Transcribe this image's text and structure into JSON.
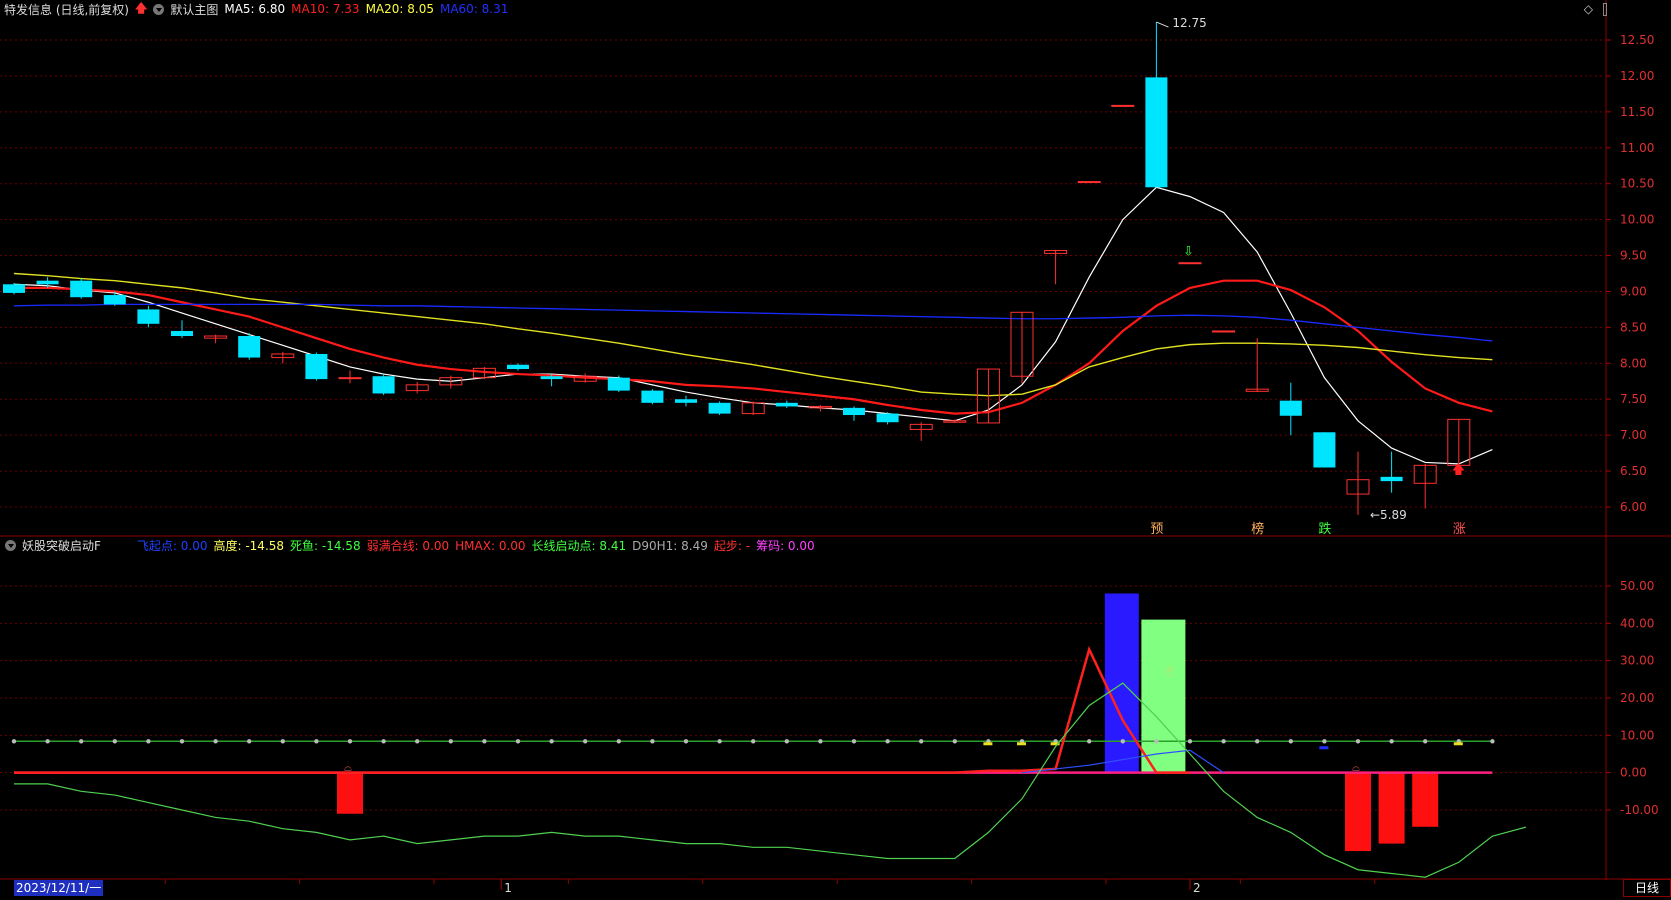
{
  "header": {
    "stock_title": "特发信息 (日线,前复权)",
    "theme_label": "默认主图",
    "ma": [
      {
        "label": "MA5: ",
        "value": "6.80",
        "color": "#ffffff"
      },
      {
        "label": "MA10: ",
        "value": "7.33",
        "color": "#ff2020"
      },
      {
        "label": "MA20: ",
        "value": "8.05",
        "color": "#ffff40"
      },
      {
        "label": "MA60: ",
        "value": "8.31",
        "color": "#2030ff"
      }
    ]
  },
  "indicator_header": {
    "name": "妖股突破启动F",
    "fields": [
      {
        "label": "飞起点: ",
        "value": "0.00",
        "color": "#2040ff"
      },
      {
        "label": "高度: ",
        "value": "-14.58",
        "color": "#ffff60"
      },
      {
        "label": "死鱼: ",
        "value": "-14.58",
        "color": "#40ff40"
      },
      {
        "label": "弱满合线: ",
        "value": "0.00",
        "color": "#ff3030"
      },
      {
        "label": "HMAX: ",
        "value": "0.00",
        "color": "#ff3030"
      },
      {
        "label": "长线启动点: ",
        "value": "8.41",
        "color": "#40ff40"
      },
      {
        "label": "D90H1: ",
        "value": "8.49",
        "color": "#aaaaaa"
      },
      {
        "label": "起步: ",
        "value": "-",
        "color": "#ff3030"
      },
      {
        "label": "筹码: ",
        "value": "0.00",
        "color": "#ff40ff"
      }
    ]
  },
  "main_axis": {
    "labels": [
      "12.75",
      "12.50",
      "12.00",
      "11.50",
      "11.00",
      "10.50",
      "10.00",
      "9.50",
      "9.00",
      "8.50",
      "8.00",
      "7.50",
      "7.00",
      "6.50",
      "6.00"
    ],
    "min": 6.0,
    "max": 12.5
  },
  "ind_axis": {
    "labels": [
      "50.00",
      "40.00",
      "30.00",
      "20.00",
      "10.00",
      "0.00",
      "-10.00"
    ],
    "min": -10,
    "max": 50
  },
  "annotations": {
    "high": "12.75",
    "low": "5.89"
  },
  "signal_labels": [
    "预",
    "榜",
    "跌",
    "涨"
  ],
  "x_axis": {
    "date": "2023/12/11/一",
    "month_marks": [
      "1",
      "2"
    ]
  },
  "period_button": "日线",
  "candles": [
    {
      "o": 9.1,
      "c": 8.98,
      "h": 9.12,
      "l": 8.96
    },
    {
      "o": 9.15,
      "c": 9.1,
      "h": 9.2,
      "l": 9.05
    },
    {
      "o": 9.15,
      "c": 8.92,
      "h": 9.18,
      "l": 8.9
    },
    {
      "o": 8.95,
      "c": 8.82,
      "h": 9.0,
      "l": 8.8
    },
    {
      "o": 8.75,
      "c": 8.55,
      "h": 8.8,
      "l": 8.5
    },
    {
      "o": 8.45,
      "c": 8.38,
      "h": 8.6,
      "l": 8.35
    },
    {
      "o": 8.35,
      "c": 8.38,
      "h": 8.4,
      "l": 8.28
    },
    {
      "o": 8.38,
      "c": 8.08,
      "h": 8.42,
      "l": 8.05
    },
    {
      "o": 8.08,
      "c": 8.13,
      "h": 8.16,
      "l": 8.0
    },
    {
      "o": 8.13,
      "c": 7.78,
      "h": 8.15,
      "l": 7.76
    },
    {
      "o": 7.8,
      "c": 7.8,
      "h": 7.9,
      "l": 7.72
    },
    {
      "o": 7.82,
      "c": 7.58,
      "h": 7.85,
      "l": 7.56
    },
    {
      "o": 7.62,
      "c": 7.7,
      "h": 7.74,
      "l": 7.58
    },
    {
      "o": 7.7,
      "c": 7.8,
      "h": 7.83,
      "l": 7.65
    },
    {
      "o": 7.8,
      "c": 7.93,
      "h": 7.95,
      "l": 7.78
    },
    {
      "o": 7.98,
      "c": 7.92,
      "h": 8.0,
      "l": 7.9
    },
    {
      "o": 7.82,
      "c": 7.78,
      "h": 7.85,
      "l": 7.68
    },
    {
      "o": 7.75,
      "c": 7.82,
      "h": 7.86,
      "l": 7.73
    },
    {
      "o": 7.8,
      "c": 7.62,
      "h": 7.83,
      "l": 7.6
    },
    {
      "o": 7.62,
      "c": 7.45,
      "h": 7.64,
      "l": 7.43
    },
    {
      "o": 7.5,
      "c": 7.45,
      "h": 7.55,
      "l": 7.4
    },
    {
      "o": 7.45,
      "c": 7.3,
      "h": 7.47,
      "l": 7.28
    },
    {
      "o": 7.3,
      "c": 7.45,
      "h": 7.47,
      "l": 7.28
    },
    {
      "o": 7.45,
      "c": 7.4,
      "h": 7.48,
      "l": 7.38
    },
    {
      "o": 7.38,
      "c": 7.4,
      "h": 7.42,
      "l": 7.33
    },
    {
      "o": 7.38,
      "c": 7.28,
      "h": 7.4,
      "l": 7.2
    },
    {
      "o": 7.3,
      "c": 7.18,
      "h": 7.32,
      "l": 7.15
    },
    {
      "o": 7.08,
      "c": 7.15,
      "h": 7.18,
      "l": 6.92
    },
    {
      "o": 7.18,
      "c": 7.2,
      "h": 7.22,
      "l": 7.17
    },
    {
      "o": 7.17,
      "c": 7.92,
      "h": 7.92,
      "l": 7.17
    },
    {
      "o": 7.82,
      "c": 8.71,
      "h": 8.71,
      "l": 7.72
    },
    {
      "o": 9.53,
      "c": 9.57,
      "h": 9.58,
      "l": 9.1
    },
    {
      "o": 10.53,
      "c": 10.53,
      "h": 10.53,
      "l": 10.53
    },
    {
      "o": 11.59,
      "c": 11.59,
      "h": 11.59,
      "l": 11.59
    },
    {
      "o": 11.98,
      "c": 10.45,
      "h": 12.75,
      "l": 10.45
    },
    {
      "o": 9.4,
      "c": 9.4,
      "h": 9.4,
      "l": 9.4
    },
    {
      "o": 8.45,
      "c": 8.45,
      "h": 8.45,
      "l": 8.45
    },
    {
      "o": 7.61,
      "c": 7.64,
      "h": 8.35,
      "l": 7.6
    },
    {
      "o": 7.48,
      "c": 7.27,
      "h": 7.73,
      "l": 7.0
    },
    {
      "o": 7.04,
      "c": 6.55,
      "h": 7.04,
      "l": 6.55
    },
    {
      "o": 6.18,
      "c": 6.38,
      "h": 6.77,
      "l": 5.89
    },
    {
      "o": 6.42,
      "c": 6.36,
      "h": 6.77,
      "l": 6.2
    },
    {
      "o": 6.33,
      "c": 6.58,
      "h": 6.6,
      "l": 5.98
    },
    {
      "o": 6.58,
      "c": 7.22,
      "h": 7.22,
      "l": 6.57
    }
  ],
  "ma_lines": {
    "ma5": [
      9.1,
      9.08,
      9.02,
      8.98,
      8.85,
      8.7,
      8.55,
      8.4,
      8.25,
      8.1,
      7.95,
      7.85,
      7.78,
      7.75,
      7.8,
      7.85,
      7.85,
      7.82,
      7.8,
      7.7,
      7.6,
      7.52,
      7.45,
      7.42,
      7.38,
      7.35,
      7.3,
      7.25,
      7.2,
      7.35,
      7.7,
      8.3,
      9.2,
      10.0,
      10.45,
      10.32,
      10.1,
      9.55,
      8.7,
      7.8,
      7.2,
      6.82,
      6.62,
      6.6,
      6.8
    ],
    "ma10": [
      9.05,
      9.05,
      9.03,
      9.0,
      8.95,
      8.85,
      8.75,
      8.65,
      8.5,
      8.35,
      8.2,
      8.08,
      7.98,
      7.92,
      7.88,
      7.85,
      7.83,
      7.8,
      7.78,
      7.75,
      7.7,
      7.68,
      7.65,
      7.6,
      7.55,
      7.5,
      7.42,
      7.35,
      7.3,
      7.32,
      7.45,
      7.7,
      8.0,
      8.45,
      8.8,
      9.05,
      9.15,
      9.15,
      9.02,
      8.78,
      8.45,
      8.02,
      7.65,
      7.45,
      7.33
    ],
    "ma20": [
      9.25,
      9.22,
      9.18,
      9.15,
      9.1,
      9.05,
      8.98,
      8.9,
      8.85,
      8.8,
      8.75,
      8.7,
      8.65,
      8.6,
      8.55,
      8.48,
      8.42,
      8.35,
      8.28,
      8.2,
      8.12,
      8.05,
      7.98,
      7.9,
      7.82,
      7.75,
      7.68,
      7.6,
      7.57,
      7.55,
      7.57,
      7.7,
      7.95,
      8.08,
      8.2,
      8.26,
      8.28,
      8.28,
      8.27,
      8.25,
      8.22,
      8.17,
      8.12,
      8.08,
      8.05
    ],
    "ma60": [
      8.8,
      8.81,
      8.81,
      8.82,
      8.82,
      8.82,
      8.82,
      8.82,
      8.82,
      8.82,
      8.81,
      8.8,
      8.8,
      8.79,
      8.78,
      8.77,
      8.76,
      8.75,
      8.74,
      8.73,
      8.72,
      8.71,
      8.7,
      8.69,
      8.68,
      8.67,
      8.66,
      8.65,
      8.64,
      8.63,
      8.62,
      8.62,
      8.63,
      8.64,
      8.66,
      8.67,
      8.66,
      8.64,
      8.6,
      8.55,
      8.5,
      8.45,
      8.4,
      8.36,
      8.31
    ]
  },
  "indicator": {
    "green_line": [
      -3,
      -3,
      -5,
      -6,
      -8,
      -10,
      -12,
      -13,
      -15,
      -16,
      -18,
      -17,
      -19,
      -18,
      -17,
      -17,
      -16,
      -17,
      -17,
      -18,
      -19,
      -19,
      -20,
      -20,
      -21,
      -22,
      -23,
      -23,
      -23,
      -16,
      -7,
      7,
      18,
      24,
      15,
      5,
      -5,
      -12,
      -16,
      -22,
      -26,
      -27,
      -28,
      -24,
      -17,
      -14.58
    ],
    "red_tri": [
      0,
      0,
      0,
      0,
      0,
      0,
      0,
      0,
      0,
      0,
      0,
      0,
      0,
      0,
      0,
      0,
      0,
      0,
      0,
      0,
      0,
      0,
      0,
      0,
      0,
      0,
      0,
      0,
      0,
      0.5,
      0.5,
      1,
      33,
      14,
      0,
      0
    ],
    "blue_bar_value": 48,
    "green_bar_value": 41,
    "neg_bars": [
      {
        "i": 10,
        "v": -11
      },
      {
        "i": 40,
        "v": -21
      },
      {
        "i": 41,
        "v": -19
      },
      {
        "i": 42,
        "v": -14.5
      }
    ]
  }
}
